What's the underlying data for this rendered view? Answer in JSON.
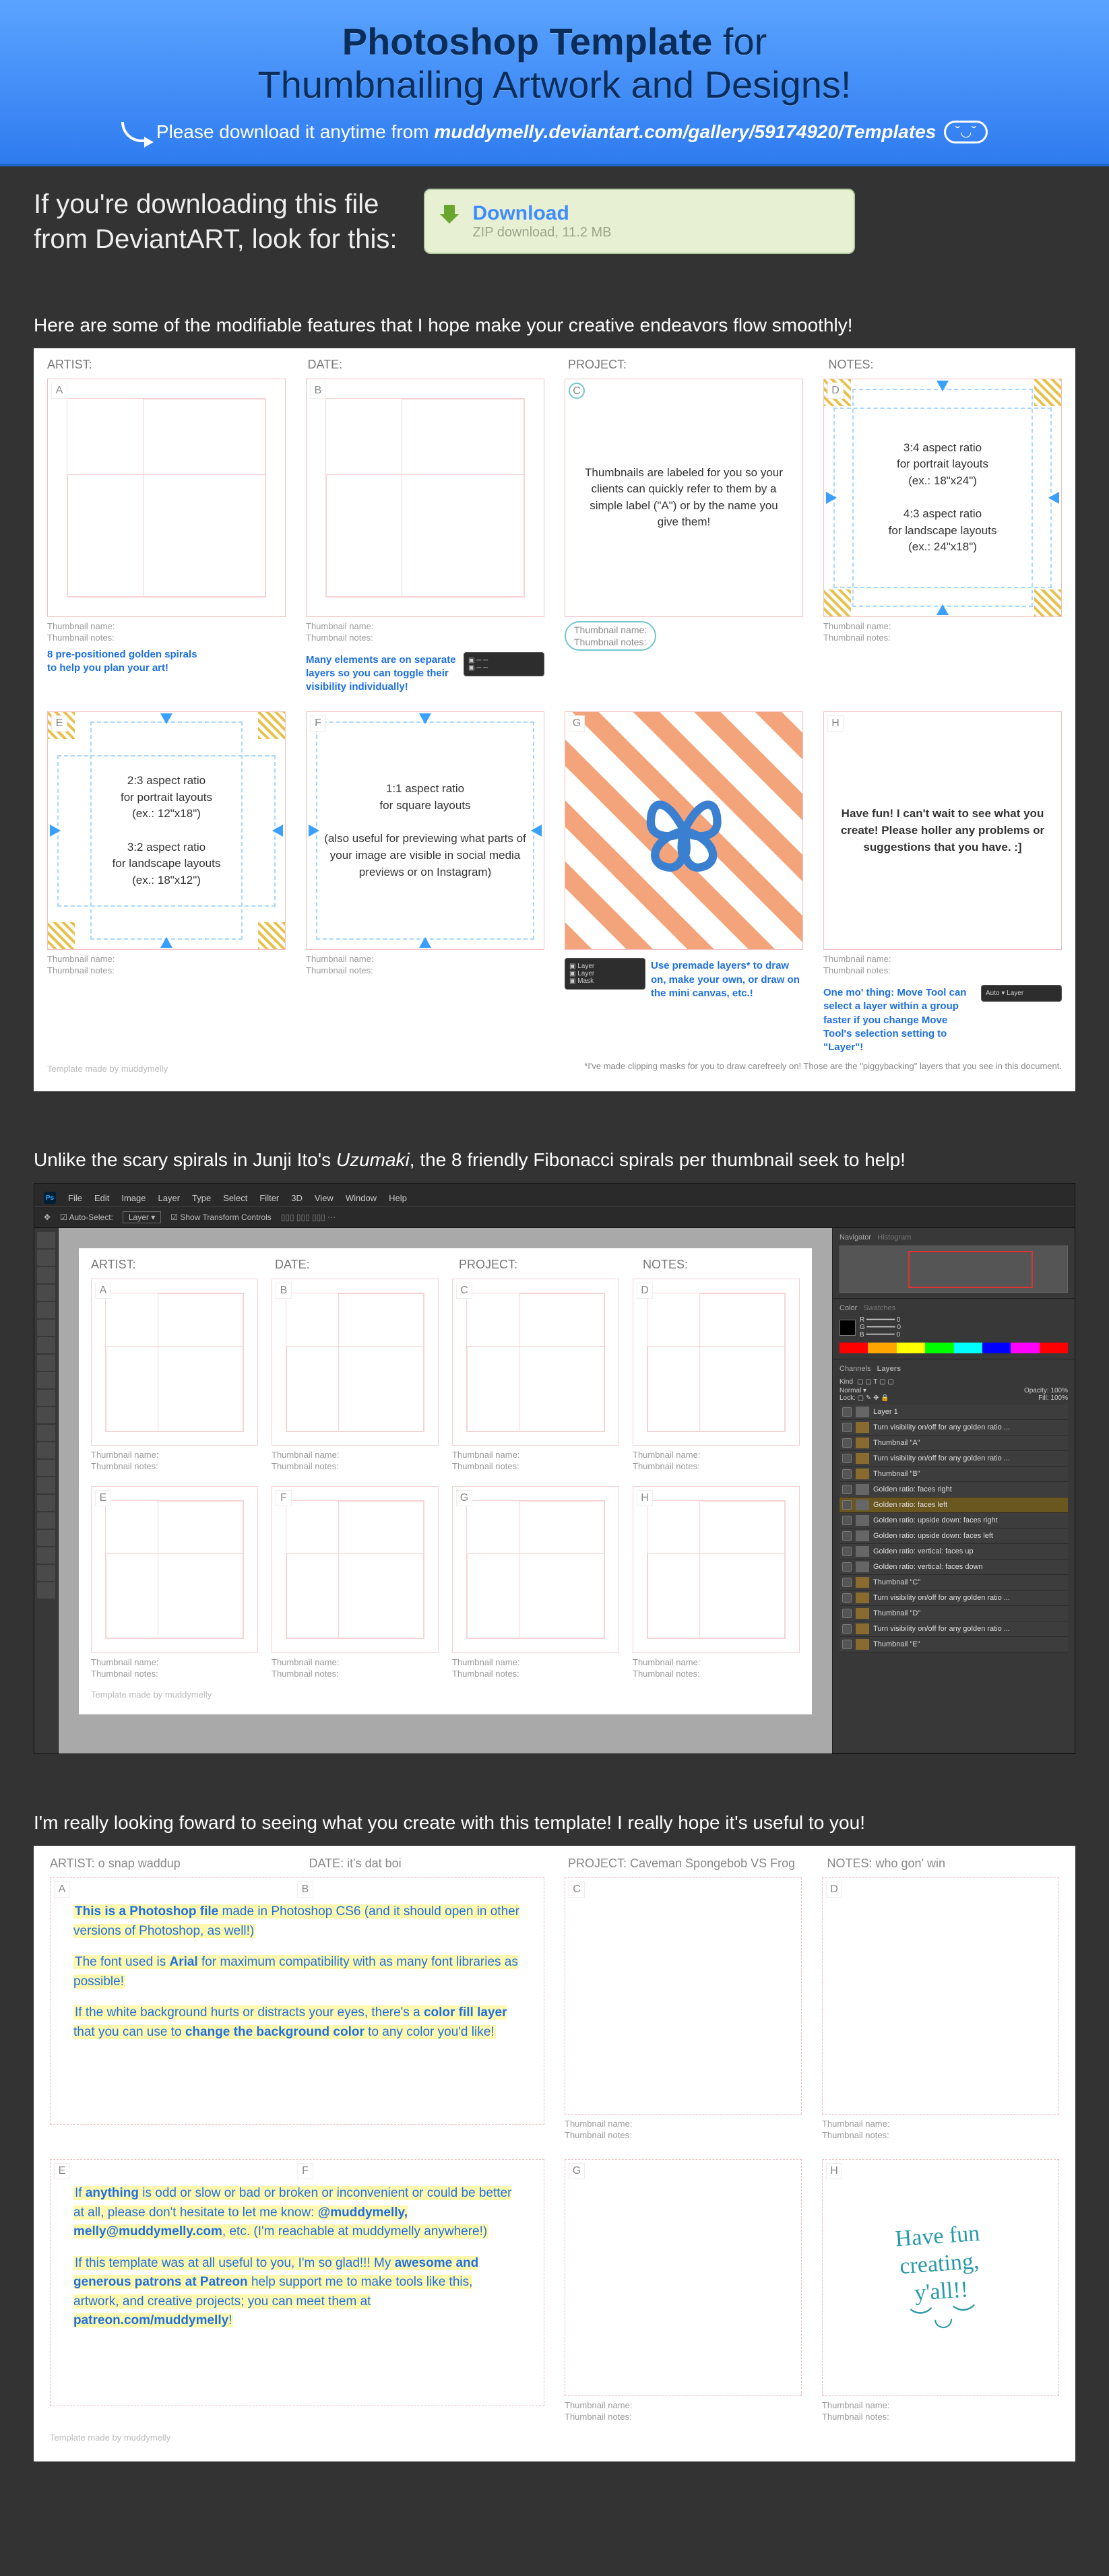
{
  "hero": {
    "title_bold": "Photoshop Template",
    "title_mid": " for",
    "title_line2": "Thumbnailing Artwork and Designs!",
    "sub_pre": "Please download it anytime from ",
    "sub_url": "muddymelly.deviantart.com/gallery/59174920/Templates",
    "face": "˘◡˘"
  },
  "dl": {
    "prompt_l1": "If you're downloading this file",
    "prompt_l2": "from DeviantART, look for this:",
    "btn_title": "Download",
    "btn_sub": "ZIP download, 11.2 MB"
  },
  "cap1": "Here are some of the modifiable features that I hope make your creative endeavors flow smoothly!",
  "cap2": "Unlike the scary spirals in Junji Ito's Uzumaki, the 8 friendly Fibonacci spirals per thumbnail seek to help!",
  "cap3": "I'm really looking foward to seeing what you create with this template! I really hope it's useful to you!",
  "head": {
    "artist": "ARTIST:",
    "date": "DATE:",
    "project": "PROJECT:",
    "notes": "NOTES:"
  },
  "meta": {
    "name": "Thumbnail name:",
    "notes": "Thumbnail notes:"
  },
  "letters": [
    "A",
    "B",
    "C",
    "D",
    "E",
    "F",
    "G",
    "H"
  ],
  "cellnotes": {
    "A": {
      "l1": "8 pre-positioned golden spirals",
      "l2": "to help you plan your art!"
    },
    "B": {
      "l1": "Many elements are on separate",
      "l2": "layers so you can toggle their",
      "l3": "visibility individually!"
    },
    "C": {
      "c1": "Thumbnails are labeled for you so your ",
      "c1o": "clients can quickly refer to them",
      "c2": " by a simple ",
      "c2o": "label (\"A\")",
      "c3": " or by the ",
      "c3o": "name",
      "c4": " you give them!",
      "circ_label": "C",
      "circ_meta1": "Thumbnail name:",
      "circ_meta2": "Thumbnail notes:"
    },
    "D": {
      "c1": "3:4 aspect ratio",
      "c1s": "for portrait layouts",
      "c1e": "(ex.: 18\"x24\")",
      "c2": "4:3 aspect ratio",
      "c2s": "for landscape layouts",
      "c2e": "(ex.: 24\"x18\")"
    },
    "E": {
      "c1": "2:3 aspect ratio",
      "c1s": "for portrait layouts",
      "c1e": "(ex.: 12\"x18\")",
      "c2": "3:2 aspect ratio",
      "c2s": "for landscape layouts",
      "c2e": "(ex.: 18\"x12\")"
    },
    "F": {
      "c1": "1:1 aspect ratio",
      "c1s": "for square layouts",
      "c2": "(also useful for previewing what parts of your image are visible in social media previews or on Instagram)"
    },
    "G": {
      "l1": "Use premade layers*",
      "l2": "to draw on, make your own, or draw on the mini canvas, etc.!"
    },
    "H": {
      "c1": "Have fun! I can't wait to see what you create! Please holler any problems or suggestions that you have. :]",
      "l1": "One mo' thing: Move Tool can select a layer within a group faster if you change Move Tool's selection setting to \"Layer\"!"
    }
  },
  "sheetfoot": "Template made by muddymelly",
  "clipmask": "*I've made clipping masks for you to draw carefreely on! Those are the \"piggybacking\" layers that you see in this document.",
  "ps": {
    "menu": [
      "File",
      "Edit",
      "Image",
      "Layer",
      "Type",
      "Select",
      "Filter",
      "3D",
      "View",
      "Window",
      "Help"
    ],
    "toolbar": {
      "auto": "Auto-Select:",
      "layer": "Layer",
      "show": "Show Transform Controls"
    },
    "panels": {
      "nav": "Navigator",
      "hist": "Histogram",
      "color": "Color",
      "swatches": "Swatches",
      "layers": "Layers",
      "channels": "Channels",
      "kind": "Kind",
      "normal": "Normal",
      "opacity": "Opacity:",
      "fill": "Fill:",
      "pct": "100%",
      "lock": "Lock:"
    },
    "layers": [
      {
        "n": "Layer 1",
        "t": "l"
      },
      {
        "n": "Turn visibility on/off for any golden ratio ...",
        "t": "f"
      },
      {
        "n": "Thumbnail \"A\"",
        "t": "f"
      },
      {
        "n": "Turn visibility on/off for any golden ratio ...",
        "t": "f"
      },
      {
        "n": "Thumbnail \"B\"",
        "t": "f"
      },
      {
        "n": "Golden ratio: faces right",
        "t": "l"
      },
      {
        "n": "Golden ratio: faces left",
        "t": "l",
        "sel": true
      },
      {
        "n": "Golden ratio: upside down: faces right",
        "t": "l"
      },
      {
        "n": "Golden ratio: upside down: faces left",
        "t": "l"
      },
      {
        "n": "Golden ratio: vertical: faces up",
        "t": "l"
      },
      {
        "n": "Golden ratio: vertical: faces down",
        "t": "l"
      },
      {
        "n": "Thumbnail \"C\"",
        "t": "f"
      },
      {
        "n": "Turn visibility on/off for any golden ratio ...",
        "t": "f"
      },
      {
        "n": "Thumbnail \"D\"",
        "t": "f"
      },
      {
        "n": "Turn visibility on/off for any golden ratio ...",
        "t": "f"
      },
      {
        "n": "Thumbnail \"E\"",
        "t": "f"
      }
    ]
  },
  "s3": {
    "head": {
      "artist": "ARTIST: o snap waddup",
      "date": "DATE: it's dat boi",
      "project": "PROJECT: Caveman Spongebob VS Frog",
      "notes": "NOTES: who gon' win"
    },
    "p1a": "This is a Photoshop file",
    "p1b": " made in Photoshop CS6 (and it should open in other versions of Photoshop, as well!)",
    "p2a": "The font used is ",
    "p2b": "Arial",
    "p2c": " for maximum compatibility with as many font libraries as possible!",
    "p3a": "If the white background hurts or distracts your eyes, there's a ",
    "p3b": "color fill layer",
    "p3c": " that you can use to ",
    "p3d": "change the background color",
    "p3e": " to any color you'd like!",
    "p4a": "If ",
    "p4b": "anything",
    "p4c": " is odd or slow or bad or broken or inconvenient or could be better at all, please don't hesitate to let me know: ",
    "p4d": "@muddymelly, melly@muddymelly.com",
    "p4e": ", etc. (I'm reachable at muddymelly anywhere!)",
    "p5a": "If this template was at all useful to you, I'm so glad!!! My ",
    "p5b": "awesome and generous patrons at Patreon",
    "p5c": " help support me to make tools like this, artwork, and creative projects; you can meet them at ",
    "p5d": "patreon.com/muddymelly",
    "p5e": "!",
    "hand_l1": "Have fun",
    "hand_l2": "creating,",
    "hand_l3": "y'all!!",
    "hand_face": "︶◡︶"
  }
}
